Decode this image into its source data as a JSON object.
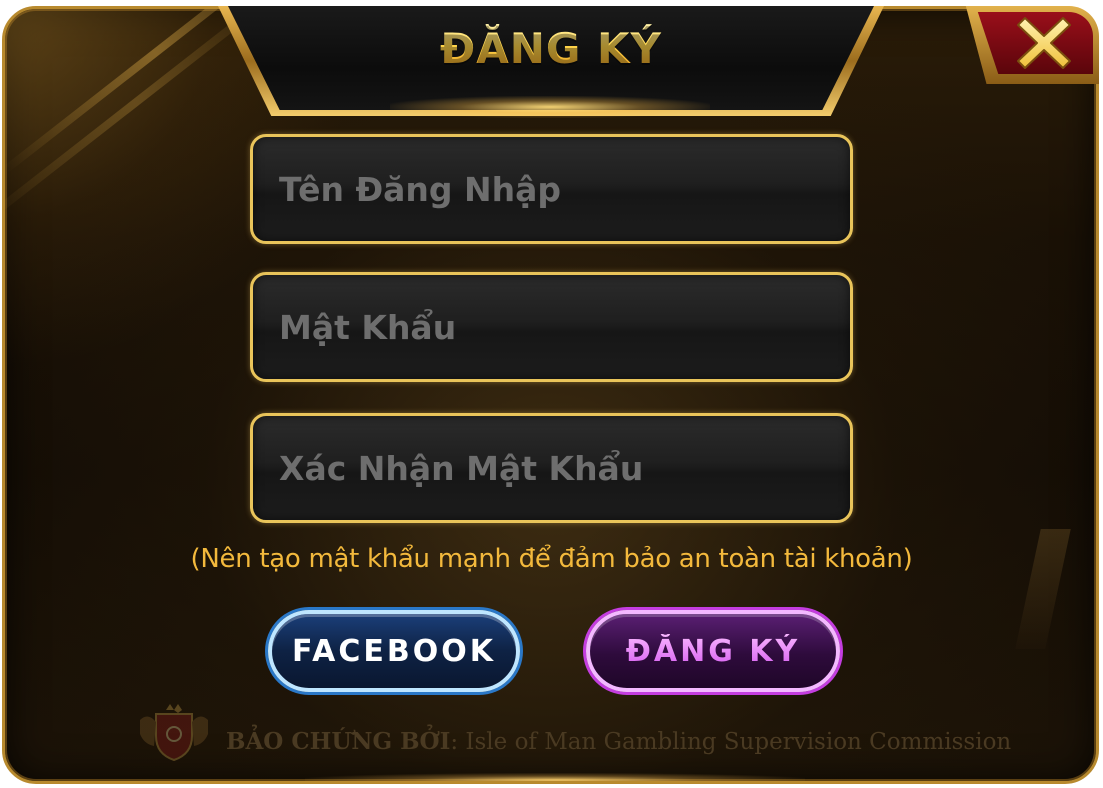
{
  "dialog": {
    "title": "ĐĂNG KÝ",
    "close_icon": "close-x-icon"
  },
  "fields": [
    {
      "placeholder": "Tên Đăng Nhập",
      "value": ""
    },
    {
      "placeholder": "Mật Khẩu",
      "value": ""
    },
    {
      "placeholder": "Xác Nhận Mật Khẩu",
      "value": ""
    }
  ],
  "hint": "(Nên tạo mật khẩu mạnh để đảm bảo an toàn tài khoản)",
  "buttons": {
    "facebook": "FACEBOOK",
    "register": "ĐĂNG KÝ"
  },
  "footer": {
    "credit_label": "BẢO CHỨNG BỞI",
    "credit_org": ": Isle of Man Gambling Supervision Commission"
  },
  "colors": {
    "accent_gold": "#e9c45a",
    "hint_text": "#f3b93c",
    "facebook_blue": "#2a78c8",
    "register_purple": "#c43de0",
    "close_red": "#9a0f1a"
  }
}
